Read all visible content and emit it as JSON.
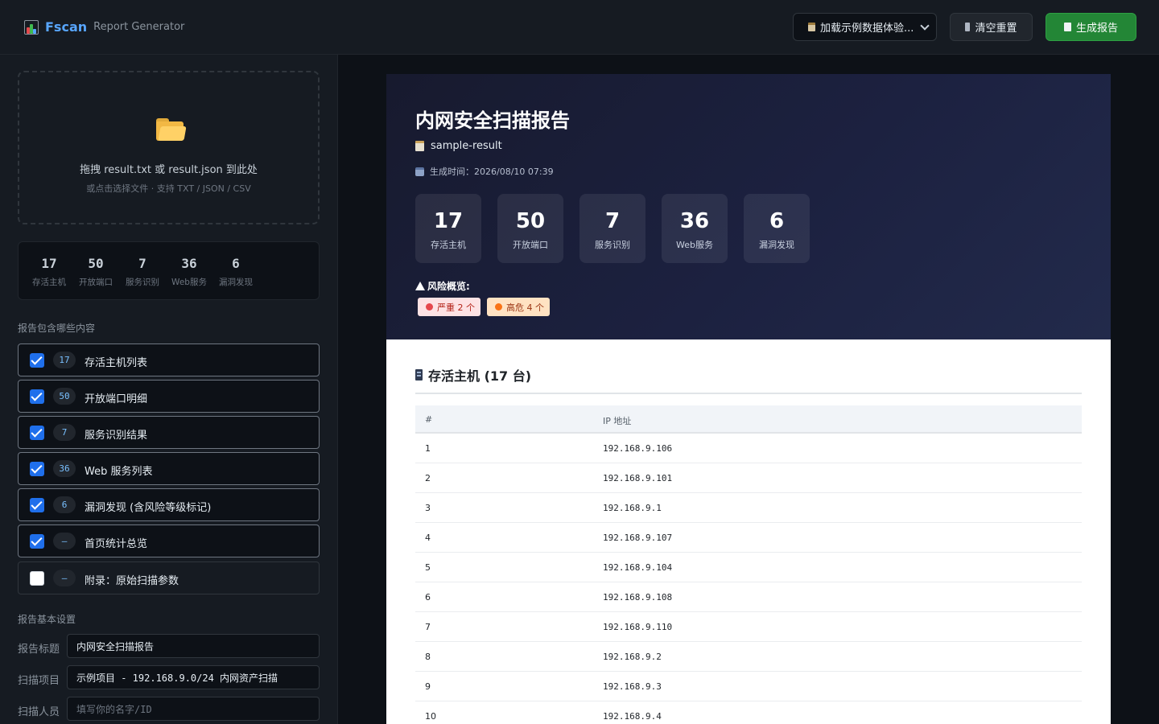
{
  "app": {
    "name": "Fscan",
    "subtitle": "Report Generator"
  },
  "header": {
    "sample_select": "加载示例数据体验...",
    "reset_button": "清空重置",
    "generate_button": "生成报告"
  },
  "sidebar": {
    "dropzone": {
      "main": "拖拽 result.txt 或 result.json 到此处",
      "sub": "或点击选择文件 · 支持 TXT / JSON / CSV"
    },
    "stats": [
      {
        "value": "17",
        "label": "存活主机"
      },
      {
        "value": "50",
        "label": "开放端口"
      },
      {
        "value": "7",
        "label": "服务识别"
      },
      {
        "value": "36",
        "label": "Web服务"
      },
      {
        "value": "6",
        "label": "漏洞发现"
      }
    ],
    "contents_title": "报告包含哪些内容",
    "options": [
      {
        "count": "17",
        "label": "存活主机列表",
        "checked": true
      },
      {
        "count": "50",
        "label": "开放端口明细",
        "checked": true
      },
      {
        "count": "7",
        "label": "服务识别结果",
        "checked": true
      },
      {
        "count": "36",
        "label": "Web 服务列表",
        "checked": true
      },
      {
        "count": "6",
        "label": "漏洞发现 (含风险等级标记)",
        "checked": true
      },
      {
        "count": "–",
        "label": "首页统计总览",
        "checked": true
      },
      {
        "count": "–",
        "label": "附录：原始扫描参数",
        "checked": false
      }
    ],
    "settings_title": "报告基本设置",
    "fields": {
      "title_label": "报告标题",
      "title_value": "内网安全扫描报告",
      "project_label": "扫描项目",
      "project_value": "示例项目 - 192.168.9.0/24 内网资产扫描",
      "scanner_label": "扫描人员",
      "scanner_placeholder": "填写你的名字/ID"
    }
  },
  "report": {
    "title": "内网安全扫描报告",
    "source": "sample-result",
    "generated": "生成时间：2026/08/10 07:39",
    "stats": [
      {
        "value": "17",
        "label": "存活主机"
      },
      {
        "value": "50",
        "label": "开放端口"
      },
      {
        "value": "7",
        "label": "服务识别"
      },
      {
        "value": "36",
        "label": "Web服务"
      },
      {
        "value": "6",
        "label": "漏洞发现"
      }
    ],
    "risk_title": "风险概览:",
    "risk_critical": "严重 2 个",
    "risk_high": "高危 4 个",
    "hosts_section": "存活主机 (17 台)",
    "table_headers": {
      "num": "#",
      "ip": "IP 地址"
    },
    "hosts": [
      {
        "n": "1",
        "ip": "192.168.9.106"
      },
      {
        "n": "2",
        "ip": "192.168.9.101"
      },
      {
        "n": "3",
        "ip": "192.168.9.1"
      },
      {
        "n": "4",
        "ip": "192.168.9.107"
      },
      {
        "n": "5",
        "ip": "192.168.9.104"
      },
      {
        "n": "6",
        "ip": "192.168.9.108"
      },
      {
        "n": "7",
        "ip": "192.168.9.110"
      },
      {
        "n": "8",
        "ip": "192.168.9.2"
      },
      {
        "n": "9",
        "ip": "192.168.9.3"
      },
      {
        "n": "10",
        "ip": "192.168.9.4"
      }
    ]
  }
}
